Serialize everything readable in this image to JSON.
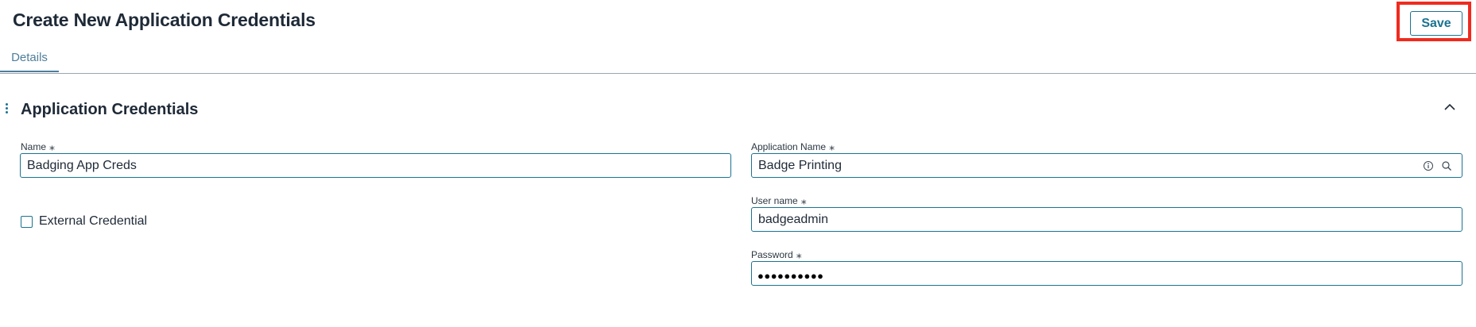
{
  "page": {
    "title": "Create New Application Credentials",
    "save_label": "Save",
    "highlight_color": "#ef2b1f",
    "accent_color": "#1b7391"
  },
  "tabs": [
    {
      "label": "Details",
      "active": true
    }
  ],
  "section": {
    "title": "Application Credentials",
    "handle_icon": "drag-handle-icon",
    "collapse_icon": "chevron-up-icon"
  },
  "form": {
    "name": {
      "label": "Name",
      "required": "⁎",
      "value": "Badging App Creds"
    },
    "application_name": {
      "label": "Application Name",
      "required": "⁎",
      "value": "Badge Printing",
      "icons": [
        "info-icon",
        "search-icon"
      ]
    },
    "external_credential": {
      "label": "External Credential",
      "checked": false
    },
    "user_name": {
      "label": "User name",
      "required": "⁎",
      "value": "badgeadmin"
    },
    "password": {
      "label": "Password",
      "required": "⁎",
      "masked_value": "●●●●●●●●●●"
    }
  }
}
